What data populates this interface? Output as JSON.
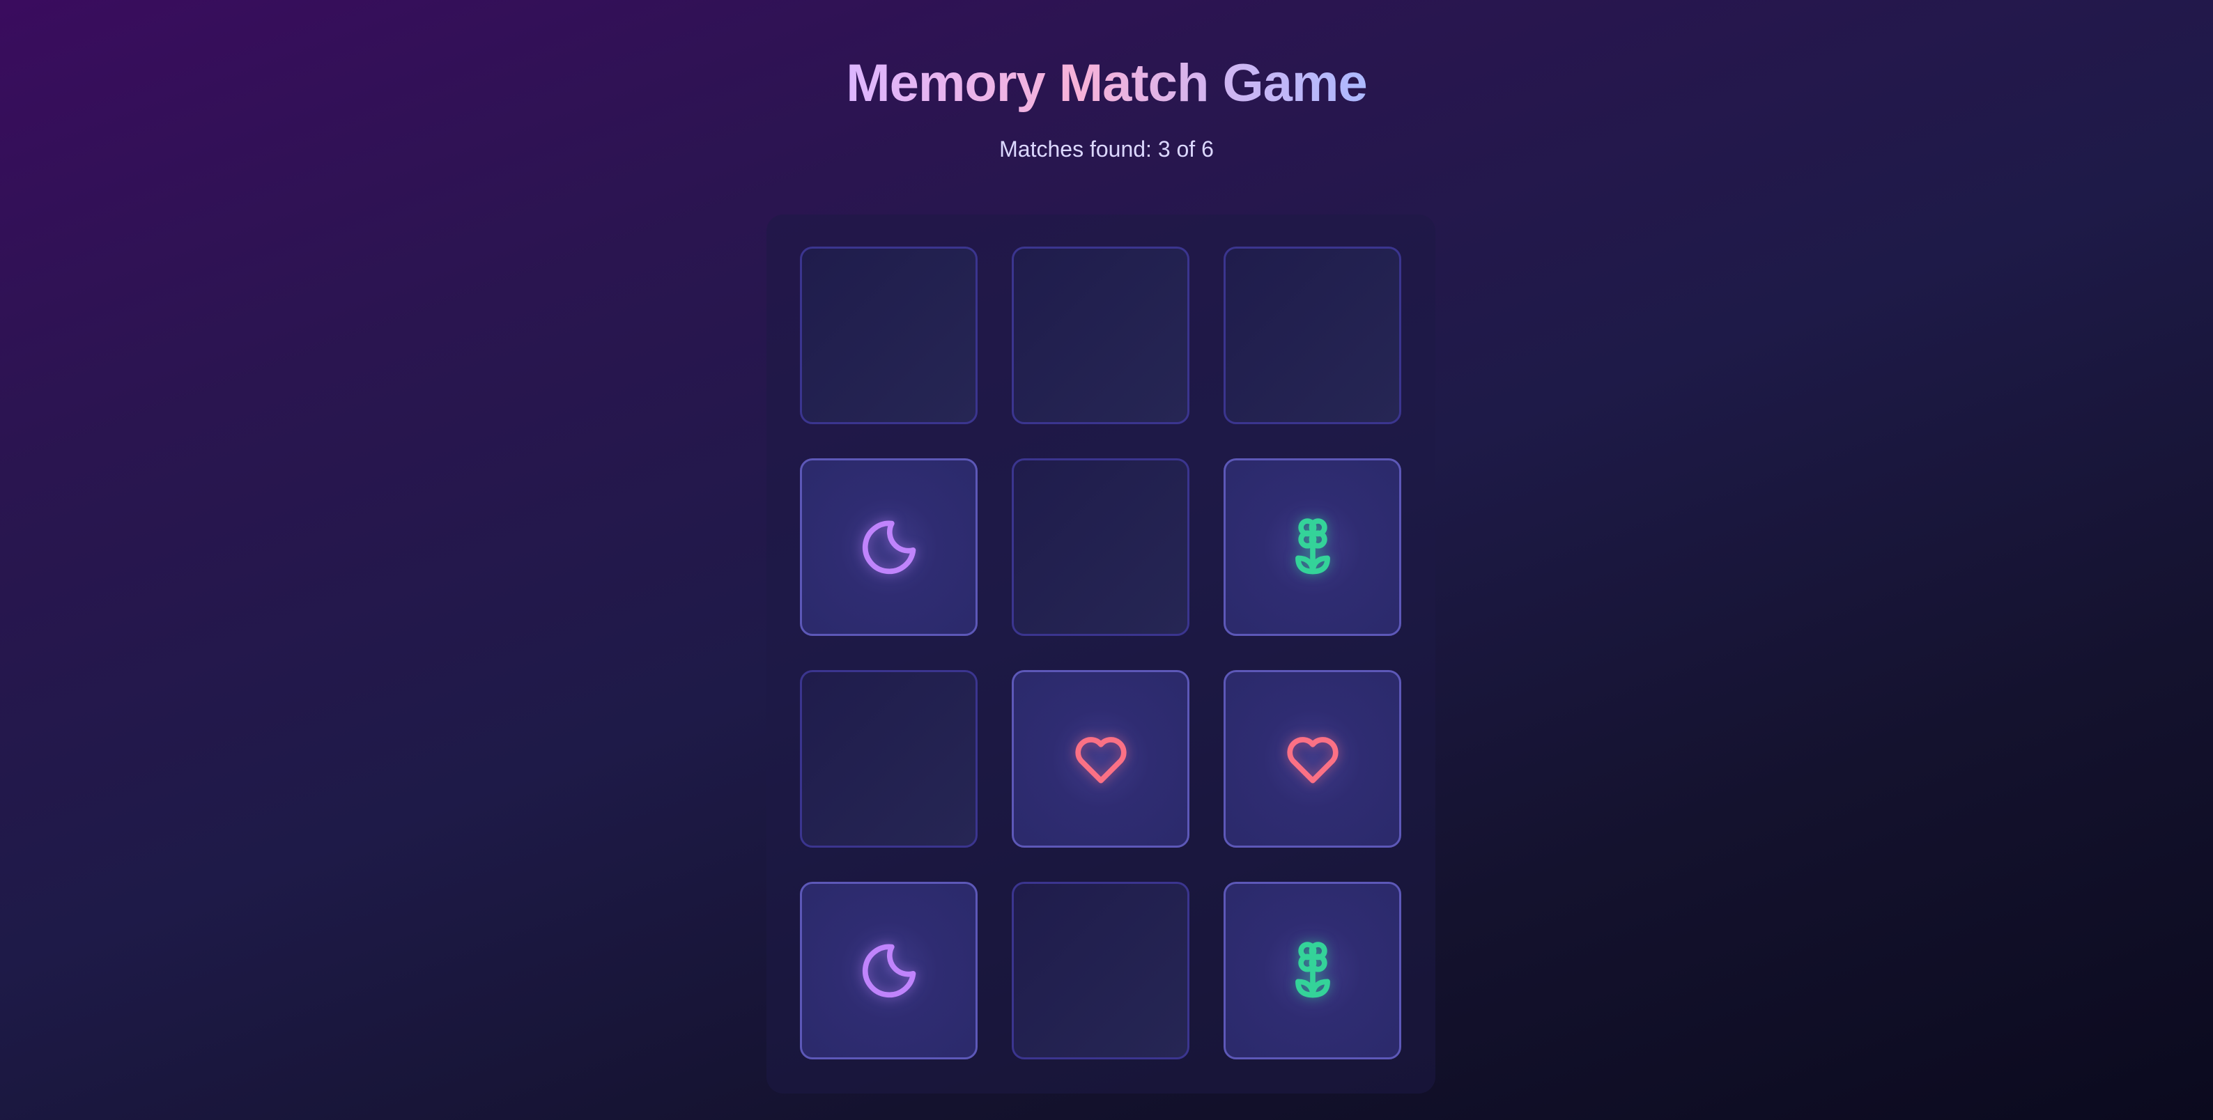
{
  "title": "Memory Match Game",
  "status": "Matches found: 3 of 6",
  "colors": {
    "moon": "#c084fc",
    "heart": "#fb7185",
    "flower": "#34d399"
  },
  "cards": [
    {
      "icon": "hidden"
    },
    {
      "icon": "hidden"
    },
    {
      "icon": "hidden"
    },
    {
      "icon": "moon"
    },
    {
      "icon": "hidden"
    },
    {
      "icon": "flower"
    },
    {
      "icon": "hidden"
    },
    {
      "icon": "heart"
    },
    {
      "icon": "heart"
    },
    {
      "icon": "moon"
    },
    {
      "icon": "hidden"
    },
    {
      "icon": "flower"
    }
  ]
}
